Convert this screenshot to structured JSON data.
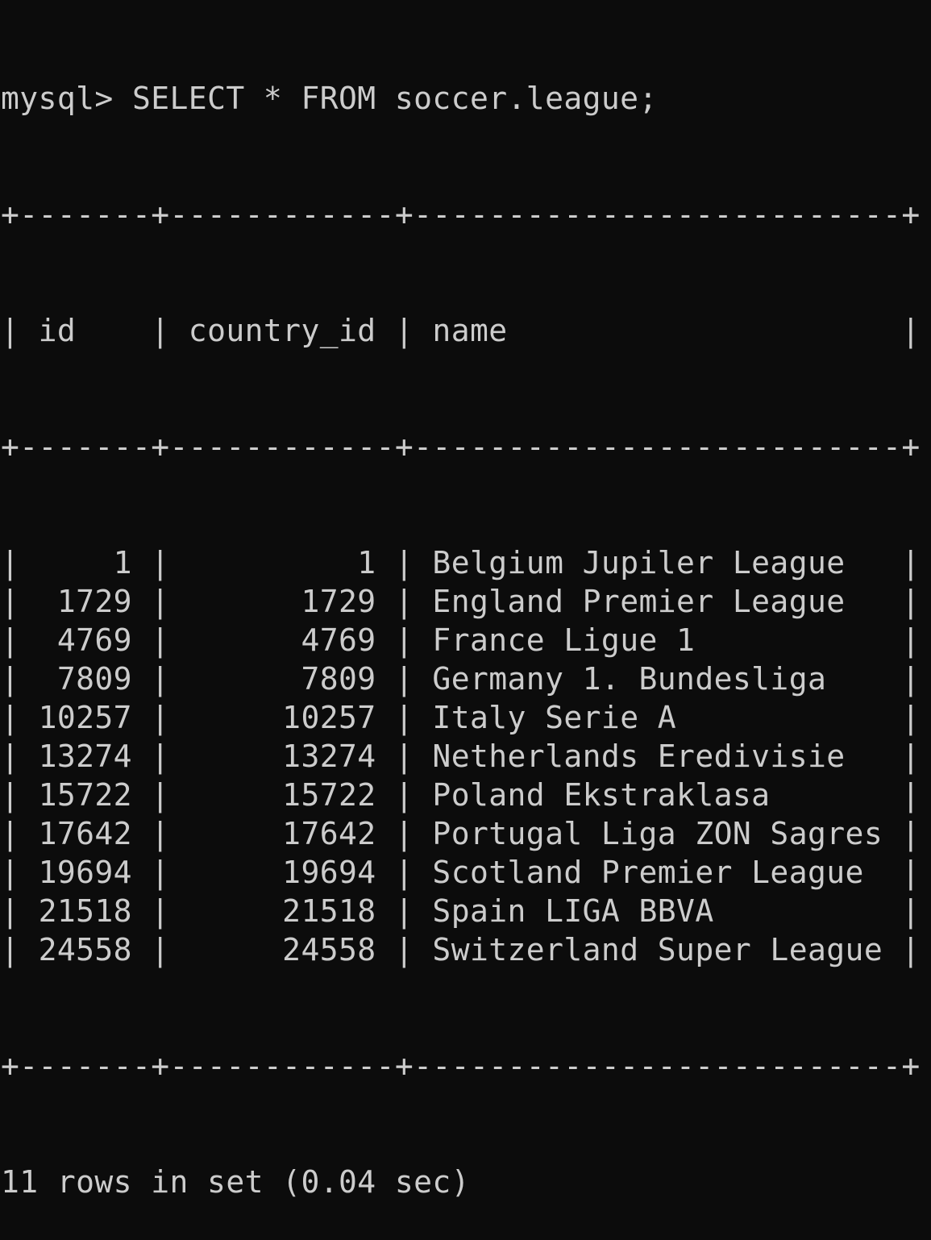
{
  "terminal": {
    "prompt": "mysql>",
    "command": "SELECT * FROM soccer.league;",
    "border_line": "+-------+------------+--------------------------+",
    "headers": [
      "id",
      "country_id",
      "name"
    ],
    "rows": [
      {
        "id": "1",
        "country_id": "1",
        "name": "Belgium Jupiler League"
      },
      {
        "id": "1729",
        "country_id": "1729",
        "name": "England Premier League"
      },
      {
        "id": "4769",
        "country_id": "4769",
        "name": "France Ligue 1"
      },
      {
        "id": "7809",
        "country_id": "7809",
        "name": "Germany 1. Bundesliga"
      },
      {
        "id": "10257",
        "country_id": "10257",
        "name": "Italy Serie A"
      },
      {
        "id": "13274",
        "country_id": "13274",
        "name": "Netherlands Eredivisie"
      },
      {
        "id": "15722",
        "country_id": "15722",
        "name": "Poland Ekstraklasa"
      },
      {
        "id": "17642",
        "country_id": "17642",
        "name": "Portugal Liga ZON Sagres"
      },
      {
        "id": "19694",
        "country_id": "19694",
        "name": "Scotland Premier League"
      },
      {
        "id": "21518",
        "country_id": "21518",
        "name": "Spain LIGA BBVA"
      },
      {
        "id": "24558",
        "country_id": "24558",
        "name": "Switzerland Super League"
      }
    ],
    "footer": "11 rows in set (0.04 sec)",
    "colors": {
      "background": "#0c0c0c",
      "text": "#cccccc"
    }
  }
}
